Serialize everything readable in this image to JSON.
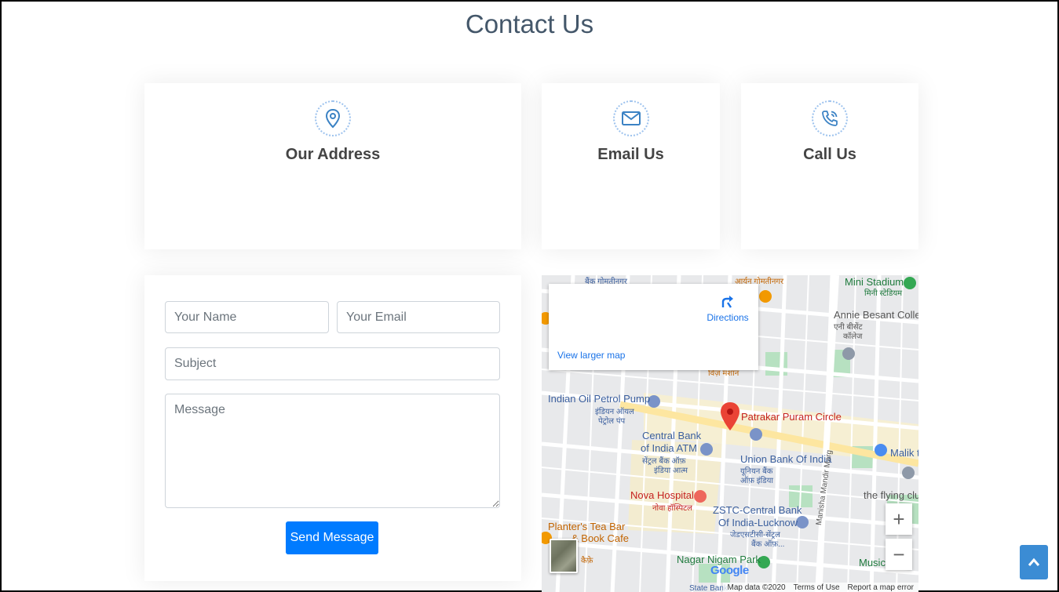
{
  "page": {
    "title": "Contact Us"
  },
  "info_cards": {
    "address": {
      "title": "Our Address",
      "icon": "map-pin-icon"
    },
    "email": {
      "title": "Email Us",
      "icon": "envelope-icon"
    },
    "call": {
      "title": "Call Us",
      "icon": "phone-icon"
    }
  },
  "form": {
    "name_placeholder": "Your Name",
    "email_placeholder": "Your Email",
    "subject_placeholder": "Subject",
    "message_placeholder": "Message",
    "send_label": "Send Message"
  },
  "map": {
    "directions_label": "Directions",
    "larger_map_label": "View larger map",
    "zoom_in": "+",
    "zoom_out": "−",
    "footer": {
      "map_data": "Map data ©2020",
      "terms": "Terms of Use",
      "report": "Report a map error"
    },
    "google_logo": "Google",
    "labels": {
      "gomtinagar_top": "बैंक गोमतीनगर",
      "aryan": "आर्यन गोमतीनगर",
      "mini_stadium": "Mini Stadium",
      "mini_stadium_hi": "मिनी स्टेडियम",
      "annie_besant": "Annie Besant Colleg",
      "annie_besant_hi1": "एनी बीसेंट",
      "annie_besant_hi2": "कॉलेज",
      "indian_oil": "Indian Oil Petrol Pump",
      "indian_oil_hi1": "इंडियन ऑयल",
      "indian_oil_hi2": "पेट्रोल पंप",
      "patrakar": "Patrakar Puram Circle",
      "central_bank1": "Central Bank",
      "central_bank2": "of India ATM",
      "central_bank_hi1": "सेंट्रल बैंक ऑफ़",
      "central_bank_hi2": "इंडिया आत्म",
      "union_bank": "Union Bank Of India",
      "union_bank_hi1": "यूनियन बैंक",
      "union_bank_hi2": "ऑफ़ इंडिया",
      "malik": "Malik t",
      "manisha": "Manisha Mandir Marg",
      "flying_club": "the flying clu",
      "nova": "Nova Hospital",
      "nova_hi": "नोवा हॉस्पिटल",
      "zstc1": "ZSTC-Central Bank",
      "zstc2": "Of India-Lucknow",
      "zstc_hi1": "जेडएसटीसी-सेंट्रल",
      "zstc_hi2": "बैंक ऑफ़...",
      "planters1": "Planter's Tea Bar",
      "planters2": "& Book Cafe",
      "planters_hi": "कैफ़े",
      "nagar_nigam": "Nagar Nigam Park",
      "music": "Music",
      "state_bank": "State Bank",
      "rise_hi": "विज़ मशान"
    }
  },
  "back_to_top": {
    "icon": "chevron-up-icon"
  },
  "colors": {
    "accent": "#007bff",
    "title": "#44576a",
    "icon_blue": "#3b82c4",
    "marker_red": "#ea4335"
  }
}
